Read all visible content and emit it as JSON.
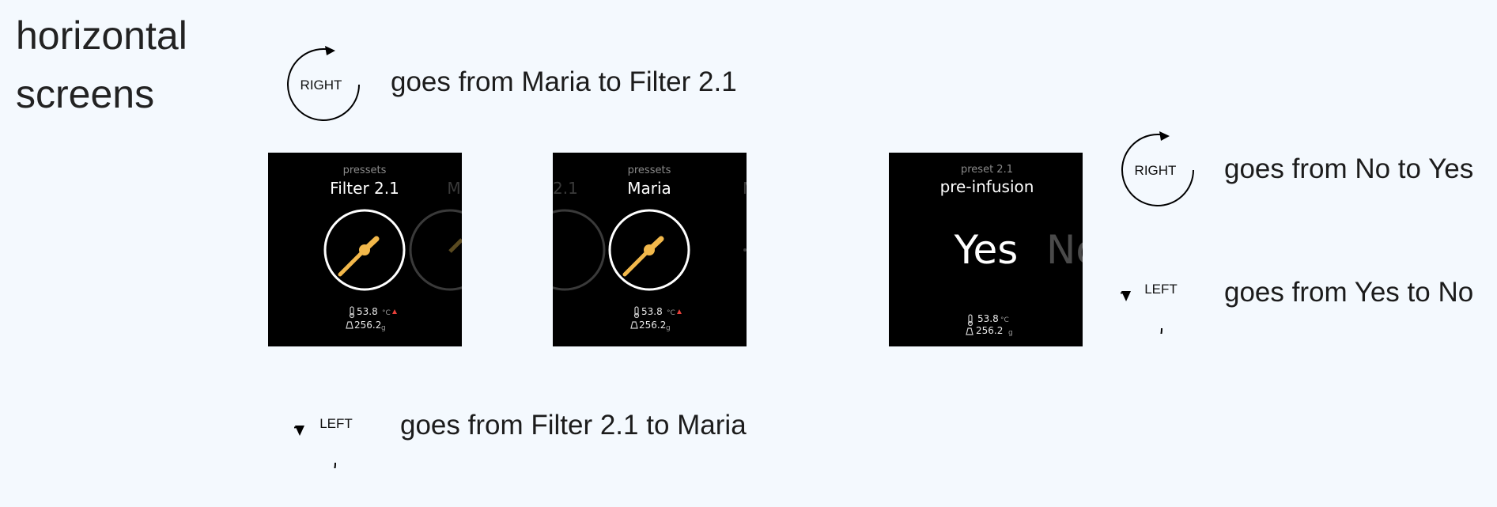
{
  "heading": {
    "line1": "horizontal",
    "line2": "screens"
  },
  "annotations": {
    "top": {
      "rotation_label": "RIGHT",
      "direction": "clockwise",
      "caption": "goes from Maria to Filter 2.1"
    },
    "bottom": {
      "rotation_label": "LEFT",
      "direction": "counterclockwise",
      "caption": "goes from Filter 2.1 to Maria"
    },
    "right_top": {
      "rotation_label": "RIGHT",
      "direction": "clockwise",
      "caption": "goes from No to Yes"
    },
    "right_bottom": {
      "rotation_label": "LEFT",
      "direction": "counterclockwise",
      "caption": "goes from Yes to No"
    }
  },
  "screens": {
    "filter": {
      "subtitle": "pressets",
      "title": "Filter 2.1",
      "temperature": "53.8",
      "temperature_unit": "°C",
      "weight": "256.2",
      "weight_unit": "g",
      "peek_title_fragment": "M"
    },
    "maria": {
      "subtitle": "pressets",
      "title": "Maria",
      "temperature": "53.8",
      "temperature_unit": "°C",
      "weight": "256.2",
      "weight_unit": "g",
      "peek_left_fragment": "2.1",
      "peek_right_fragment": "M"
    },
    "preinfusion": {
      "subtitle": "preset 2.1",
      "title": "pre-infusion",
      "selected_option": "Yes",
      "next_option": "No",
      "temperature": "53.8",
      "temperature_unit": "°C",
      "weight": "256.2",
      "weight_unit": "g"
    }
  },
  "colors": {
    "background": "#f4f9fe",
    "screen_background": "#000000",
    "accent": "#f2b84b",
    "alert": "#e8403a",
    "dial_ring": "#ffffff"
  }
}
